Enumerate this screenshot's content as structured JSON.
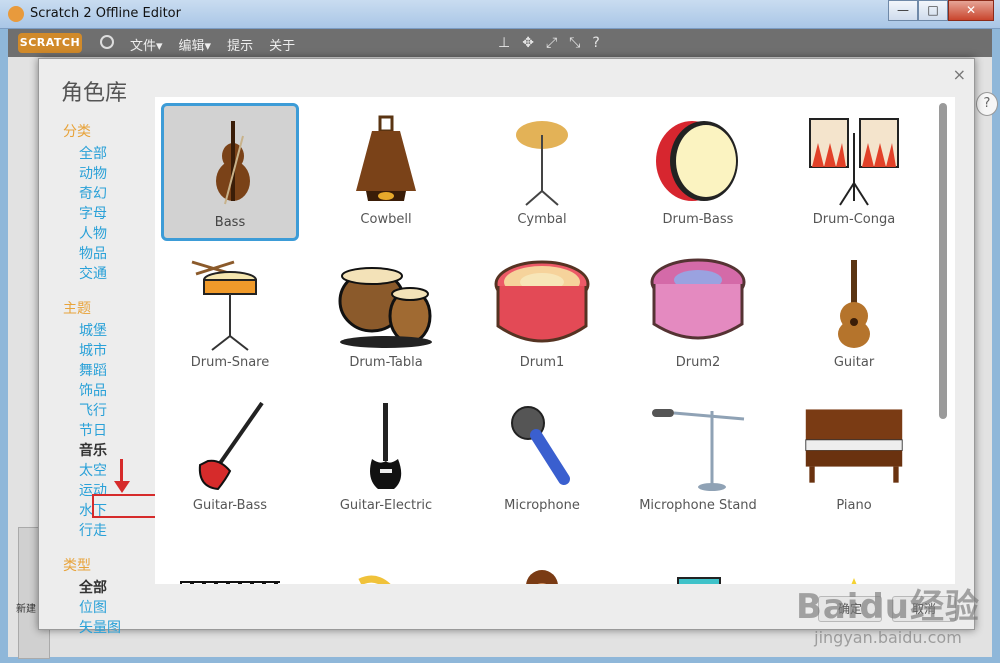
{
  "window": {
    "title": "Scratch 2 Offline Editor",
    "buttons": [
      "—",
      "□",
      "✕"
    ]
  },
  "menubar": {
    "logo": "SCRATCH",
    "items": [
      "文件▾",
      "编辑▾",
      "提示",
      "关于"
    ],
    "tools": [
      "⊥",
      "✥",
      "⤢",
      "⤡",
      "?"
    ]
  },
  "modal": {
    "title": "角色库",
    "close": "×",
    "categories": {
      "head": "分类",
      "items": [
        "全部",
        "动物",
        "奇幻",
        "字母",
        "人物",
        "物品",
        "交通"
      ]
    },
    "themes": {
      "head": "主题",
      "items": [
        "城堡",
        "城市",
        "舞蹈",
        "饰品",
        "飞行",
        "节日",
        "音乐",
        "太空",
        "运动",
        "水下",
        "行走"
      ]
    },
    "types": {
      "head": "类型",
      "items": [
        "全部",
        "位图",
        "矢量图"
      ]
    },
    "sprites": [
      "Bass",
      "Cowbell",
      "Cymbal",
      "Drum-Bass",
      "Drum-Conga",
      "Drum-Snare",
      "Drum-Tabla",
      "Drum1",
      "Drum2",
      "Guitar",
      "Guitar-Bass",
      "Guitar-Electric",
      "Microphone",
      "Microphone Stand",
      "Piano",
      "",
      "",
      "",
      "",
      ""
    ],
    "selected_sprite": "Bass",
    "ok": "确定",
    "cancel": "取消"
  },
  "side_help": "?",
  "left_caption": "新建",
  "watermark": {
    "line1": "Baidu经验",
    "line2": "jingyan.baidu.com"
  },
  "colors": {
    "accent": "#3d9cd7",
    "category": "#2aa1d8",
    "heading": "#e8a33a",
    "highlight": "#d62b2b"
  }
}
